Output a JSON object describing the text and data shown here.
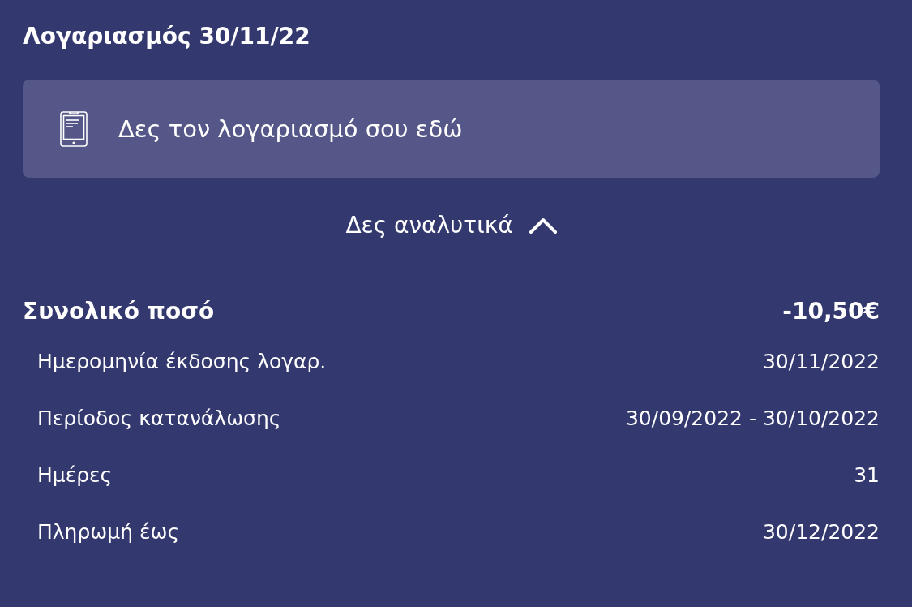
{
  "title": "Λογαριασμός 30/11/22",
  "bill_link": {
    "label": "Δες τον λογαριασμό σου εδώ"
  },
  "details_toggle": {
    "label": "Δες αναλυτικά",
    "expanded": true
  },
  "total": {
    "label": "Συνολικό ποσό",
    "value": "-10,50€"
  },
  "details": [
    {
      "label": "Ημερομηνία έκδοσης λογαρ.",
      "value": "30/11/2022"
    },
    {
      "label": "Περίοδος κατανάλωσης",
      "value": "30/09/2022 - 30/10/2022"
    },
    {
      "label": "Ημέρες",
      "value": "31"
    },
    {
      "label": "Πληρωμή έως",
      "value": "30/12/2022"
    }
  ]
}
